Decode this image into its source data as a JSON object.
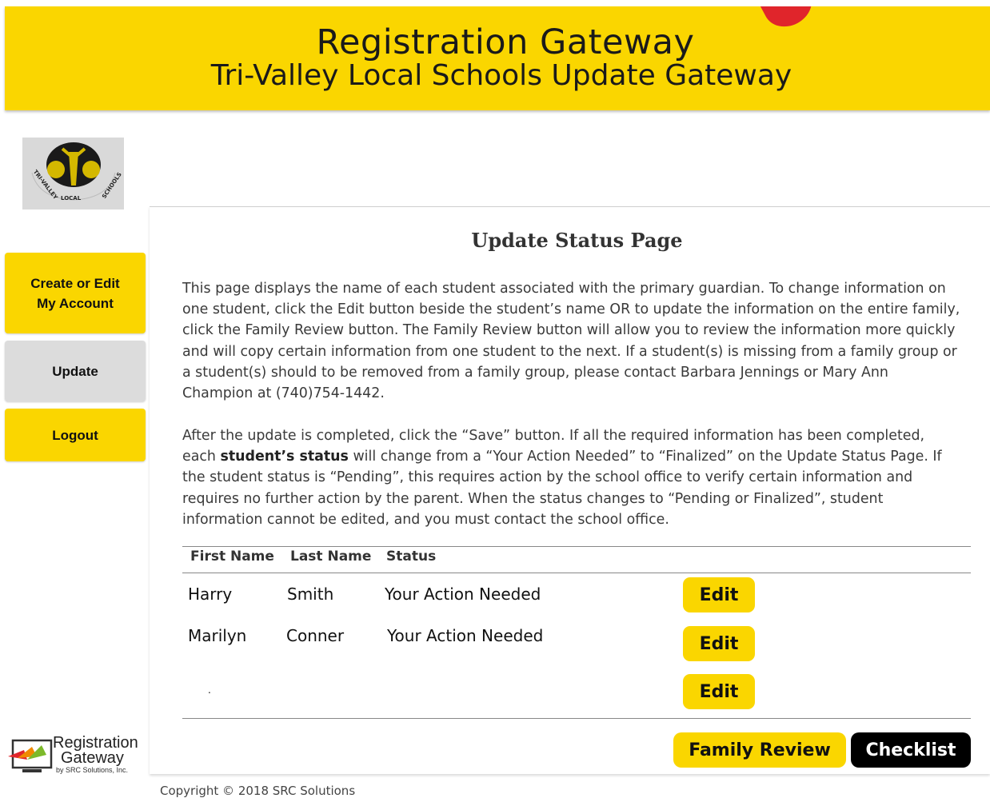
{
  "header": {
    "title": "Registration Gateway",
    "subtitle": "Tri-Valley Local Schools Update Gateway",
    "accent_color": "#fad600",
    "swoosh_color": "#e0252b"
  },
  "school_logo": {
    "text": "TRI-VALLEY LOCAL SCHOOLS",
    "icon": "school-seal-icon"
  },
  "sidebar": {
    "items": [
      {
        "label_line1": "Create or Edit",
        "label_line2": "My Account"
      },
      {
        "label": "Update",
        "active": true
      },
      {
        "label": "Logout"
      }
    ]
  },
  "main": {
    "title": "Update Status Page",
    "para1": "This page displays the name of each student associated with the primary guardian. To change information on one student, click the Edit button beside the student’s name OR to update the information on the entire family, click the Family Review button. The Family Review button will allow you to review the information more quickly and will copy certain information from one student to the next. If a student(s) is missing from a family group or a student(s) should to be removed from a family group, please contact Barbara Jennings or Mary Ann Champion at (740)754-1442.",
    "para2_a": "After the update is completed, click the “Save” button. If all the required information has been completed, each ",
    "para2_bold": "student’s status",
    "para2_b": " will change from a “Your Action Needed” to “Finalized” on the Update Status Page. If the student status is “Pending”, this requires action by the school office to verify certain information and requires no further action by the parent. When the status changes to “Pending or Finalized”, student information cannot be edited, and you must contact the school office.",
    "table": {
      "headers": [
        "First Name",
        "Last Name",
        "Status"
      ],
      "rows": [
        {
          "first": "Harry",
          "last": "Smith",
          "status": "Your Action Needed",
          "action": "Edit"
        },
        {
          "first": "Marilyn",
          "last": "Conner",
          "status": "Your Action Needed",
          "action": "Edit"
        },
        {
          "first": ".",
          "last": "",
          "status": "",
          "action": "Edit"
        }
      ]
    },
    "family_review_label": "Family Review",
    "checklist_label": "Checklist"
  },
  "footer": {
    "copyright": "Copyright © 2018 SRC Solutions",
    "brand_line1": "Registration",
    "brand_line2": "Gateway",
    "brand_line3": "by SRC Solutions, Inc."
  }
}
